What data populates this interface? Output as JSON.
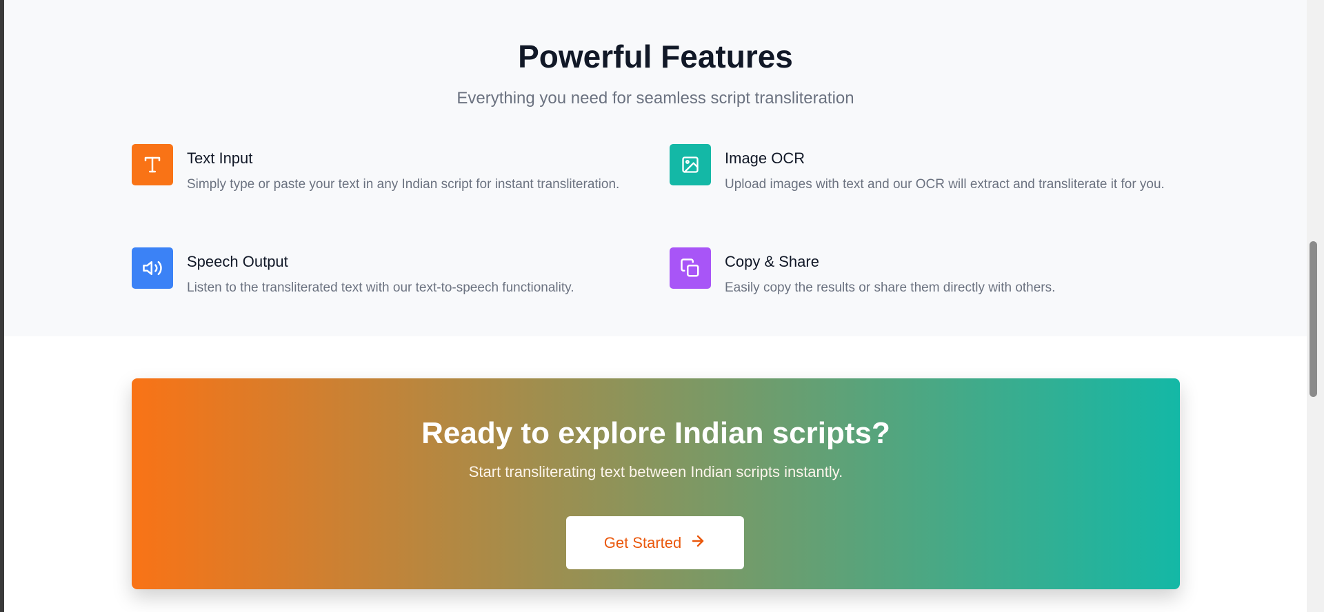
{
  "features_section": {
    "title": "Powerful Features",
    "subtitle": "Everything you need for seamless script transliteration",
    "items": [
      {
        "title": "Text Input",
        "description": "Simply type or paste your text in any Indian script for instant transliteration.",
        "icon": "text-type-icon",
        "color": "#f97316"
      },
      {
        "title": "Image OCR",
        "description": "Upload images with text and our OCR will extract and transliterate it for you.",
        "icon": "image-icon",
        "color": "#14b8a6"
      },
      {
        "title": "Speech Output",
        "description": "Listen to the transliterated text with our text-to-speech functionality.",
        "icon": "speaker-icon",
        "color": "#3b82f6"
      },
      {
        "title": "Copy & Share",
        "description": "Easily copy the results or share them directly with others.",
        "icon": "copy-icon",
        "color": "#a855f7"
      }
    ]
  },
  "cta": {
    "title": "Ready to explore Indian scripts?",
    "subtitle": "Start transliterating text between Indian scripts instantly.",
    "button_label": "Get Started",
    "button_icon": "arrow-right-icon",
    "gradient_start": "#f97316",
    "gradient_end": "#14b8a6"
  }
}
